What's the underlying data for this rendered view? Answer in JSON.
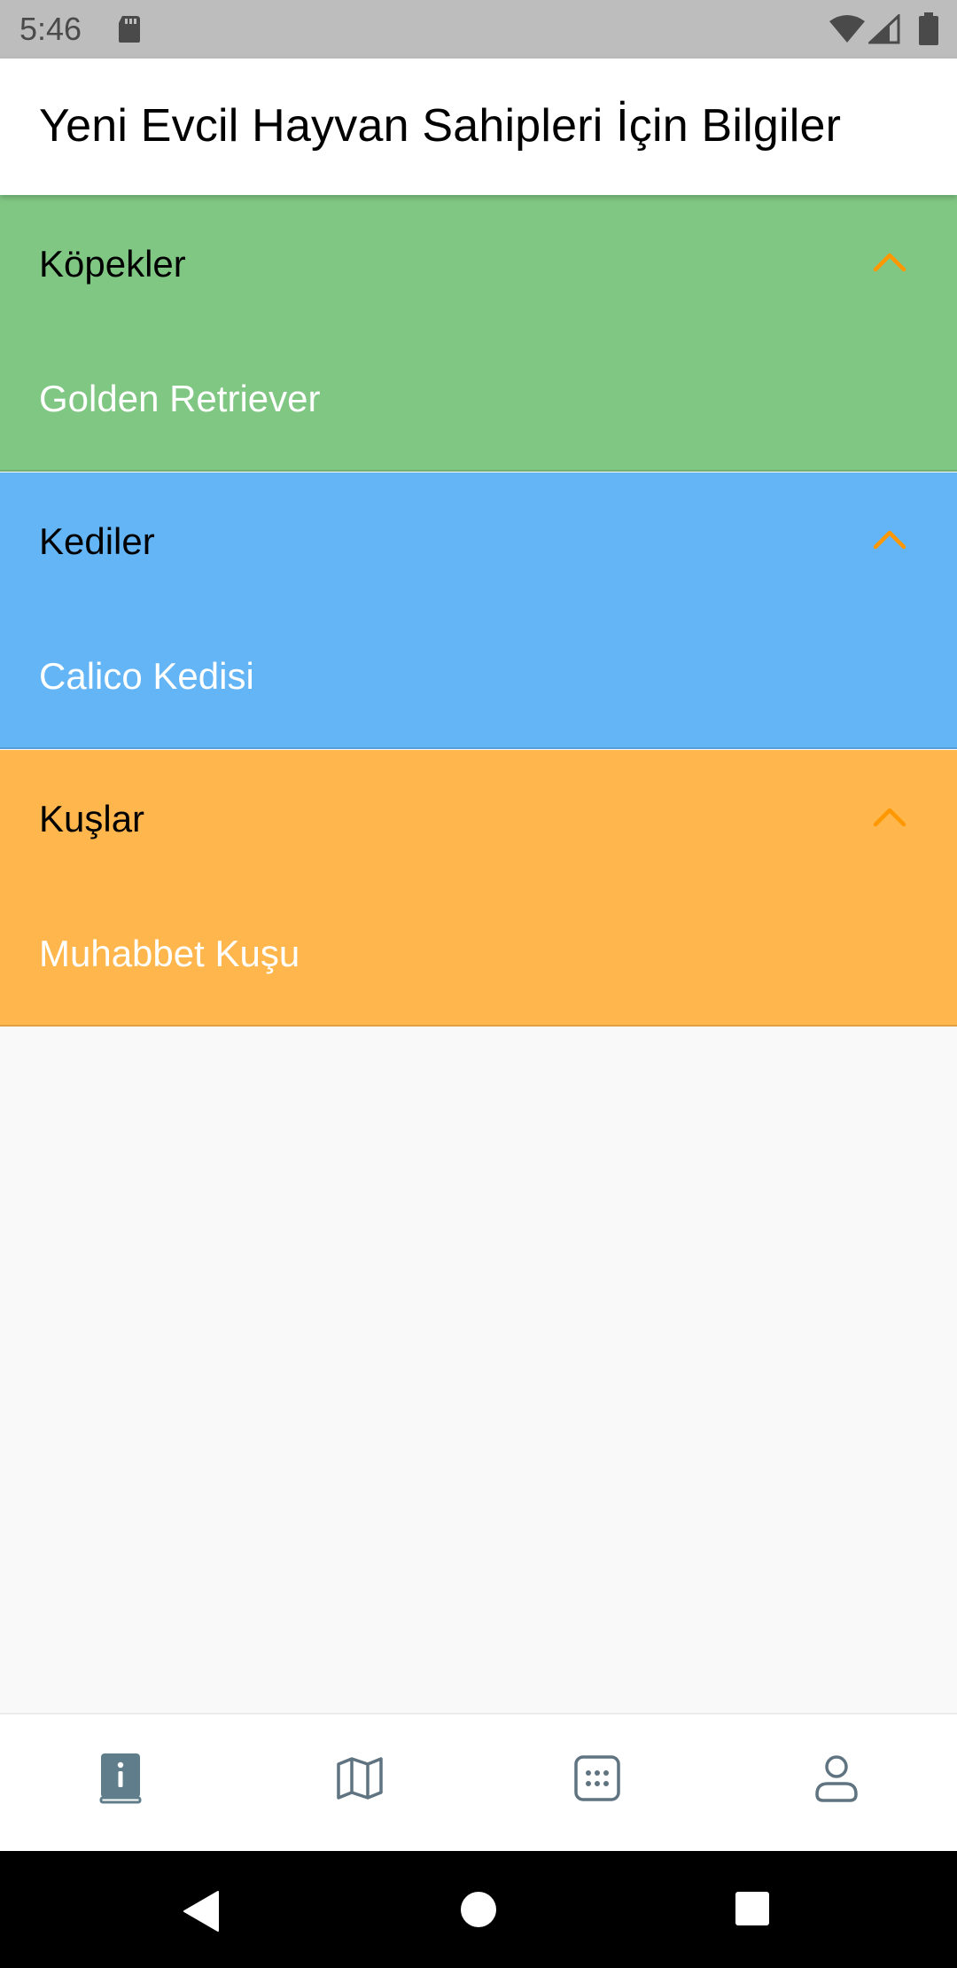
{
  "status_bar": {
    "time": "5:46",
    "icons": [
      "sd-card-icon",
      "wifi-icon",
      "signal-icon",
      "battery-icon"
    ]
  },
  "app_bar": {
    "title": "Yeni Evcil Hayvan Sahipleri İçin Bilgiler"
  },
  "panels": [
    {
      "title": "Köpekler",
      "item": "Golden Retriever",
      "color": "#81c784",
      "expanded": true
    },
    {
      "title": "Kediler",
      "item": "Calico Kedisi",
      "color": "#64b5f6",
      "expanded": true
    },
    {
      "title": "Kuşlar",
      "item": "Muhabbet Kuşu",
      "color": "#ffb74d",
      "expanded": true
    }
  ],
  "colors": {
    "chevron": "#ff9800",
    "nav_icon": "#5f7380",
    "nav_icon_active": "#607d8b"
  },
  "bottom_nav": {
    "items": [
      {
        "icon": "info-book-icon",
        "active": true
      },
      {
        "icon": "map-icon",
        "active": false
      },
      {
        "icon": "grid-dots-icon",
        "active": false
      },
      {
        "icon": "person-icon",
        "active": false
      }
    ]
  },
  "system_nav": {
    "buttons": [
      "back-icon",
      "home-icon",
      "recents-icon"
    ]
  }
}
